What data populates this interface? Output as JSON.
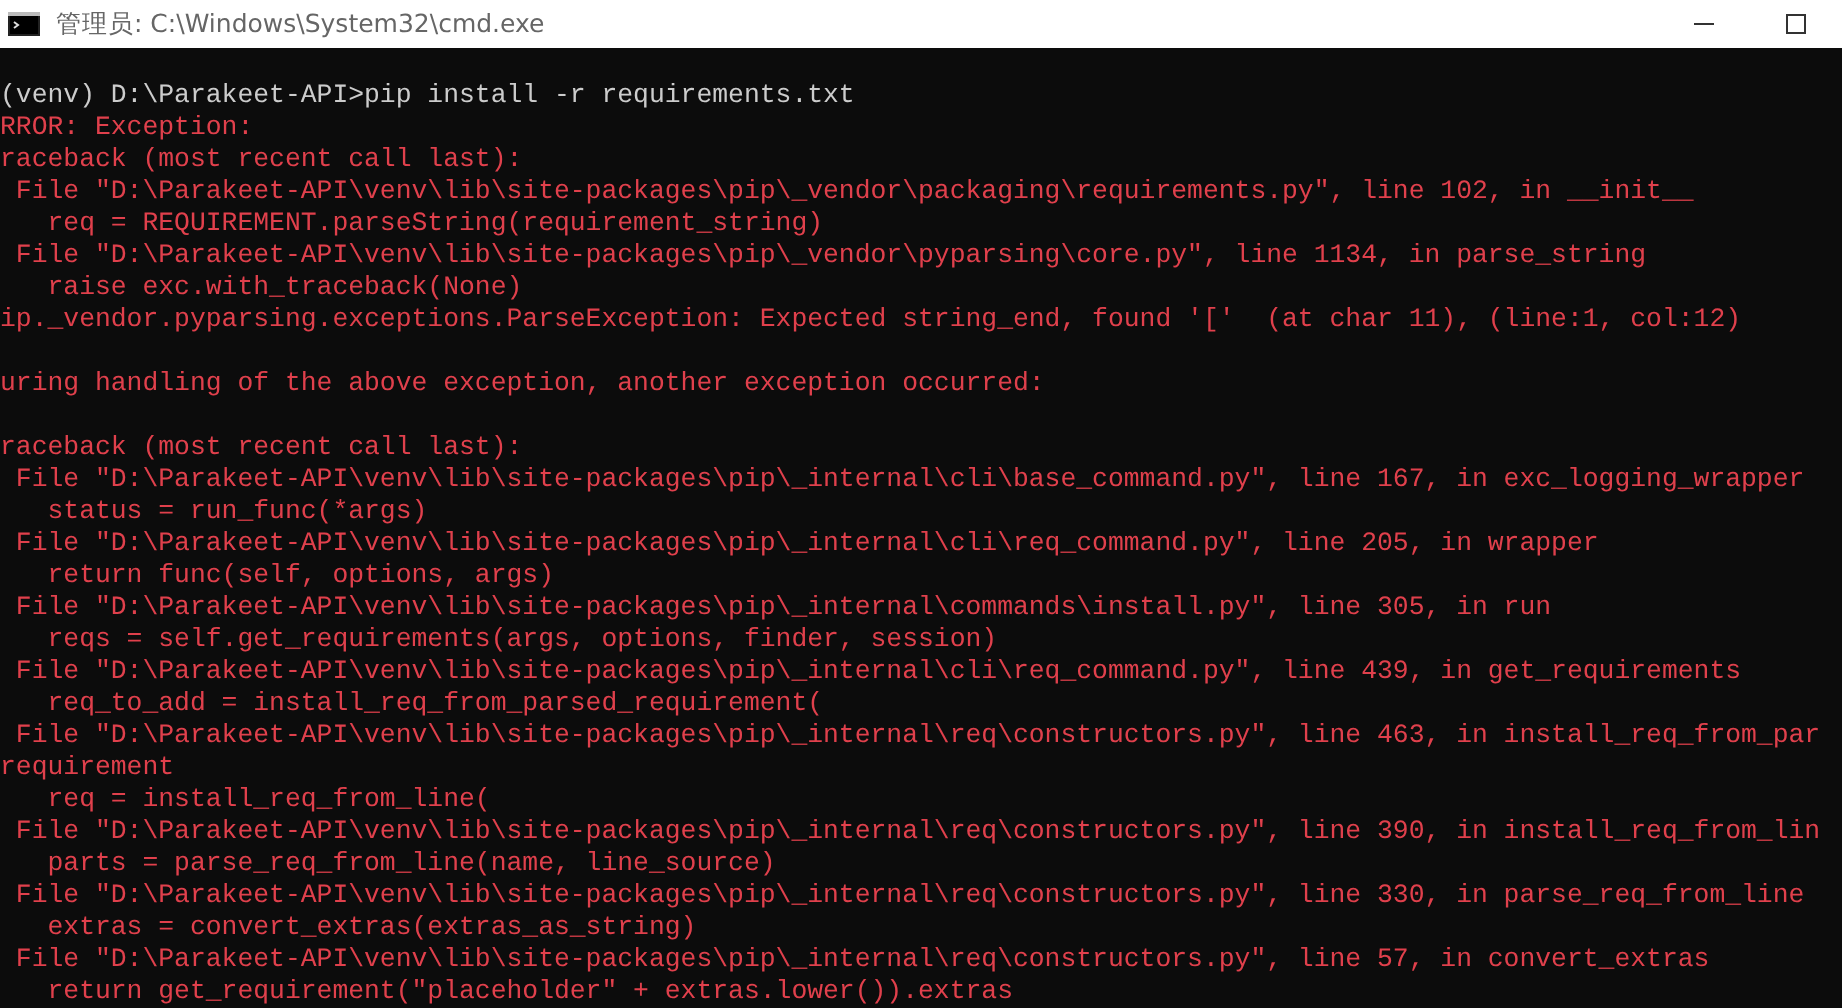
{
  "window": {
    "title": "管理员: C:\\Windows\\System32\\cmd.exe"
  },
  "console": {
    "lines": [
      {
        "kind": "command",
        "text": "(venv) D:\\Parakeet-API>pip install -r requirements.txt"
      },
      {
        "kind": "error",
        "text": "RROR: Exception:"
      },
      {
        "kind": "error",
        "text": "raceback (most recent call last):"
      },
      {
        "kind": "error",
        "text": " File \"D:\\Parakeet-API\\venv\\lib\\site-packages\\pip\\_vendor\\packaging\\requirements.py\", line 102, in __init__"
      },
      {
        "kind": "error",
        "text": "   req = REQUIREMENT.parseString(requirement_string)"
      },
      {
        "kind": "error",
        "text": " File \"D:\\Parakeet-API\\venv\\lib\\site-packages\\pip\\_vendor\\pyparsing\\core.py\", line 1134, in parse_string"
      },
      {
        "kind": "error",
        "text": "   raise exc.with_traceback(None)"
      },
      {
        "kind": "error",
        "text": "ip._vendor.pyparsing.exceptions.ParseException: Expected string_end, found '['  (at char 11), (line:1, col:12)"
      },
      {
        "kind": "blank"
      },
      {
        "kind": "error",
        "text": "uring handling of the above exception, another exception occurred:"
      },
      {
        "kind": "blank"
      },
      {
        "kind": "error",
        "text": "raceback (most recent call last):"
      },
      {
        "kind": "error",
        "text": " File \"D:\\Parakeet-API\\venv\\lib\\site-packages\\pip\\_internal\\cli\\base_command.py\", line 167, in exc_logging_wrapper"
      },
      {
        "kind": "error",
        "text": "   status = run_func(*args)"
      },
      {
        "kind": "error",
        "text": " File \"D:\\Parakeet-API\\venv\\lib\\site-packages\\pip\\_internal\\cli\\req_command.py\", line 205, in wrapper"
      },
      {
        "kind": "error",
        "text": "   return func(self, options, args)"
      },
      {
        "kind": "error",
        "text": " File \"D:\\Parakeet-API\\venv\\lib\\site-packages\\pip\\_internal\\commands\\install.py\", line 305, in run"
      },
      {
        "kind": "error",
        "text": "   reqs = self.get_requirements(args, options, finder, session)"
      },
      {
        "kind": "error",
        "text": " File \"D:\\Parakeet-API\\venv\\lib\\site-packages\\pip\\_internal\\cli\\req_command.py\", line 439, in get_requirements"
      },
      {
        "kind": "error",
        "text": "   req_to_add = install_req_from_parsed_requirement("
      },
      {
        "kind": "error",
        "text": " File \"D:\\Parakeet-API\\venv\\lib\\site-packages\\pip\\_internal\\req\\constructors.py\", line 463, in install_req_from_par"
      },
      {
        "kind": "error",
        "text": "requirement"
      },
      {
        "kind": "error",
        "text": "   req = install_req_from_line("
      },
      {
        "kind": "error",
        "text": " File \"D:\\Parakeet-API\\venv\\lib\\site-packages\\pip\\_internal\\req\\constructors.py\", line 390, in install_req_from_lin"
      },
      {
        "kind": "error",
        "text": "   parts = parse_req_from_line(name, line_source)"
      },
      {
        "kind": "error",
        "text": " File \"D:\\Parakeet-API\\venv\\lib\\site-packages\\pip\\_internal\\req\\constructors.py\", line 330, in parse_req_from_line"
      },
      {
        "kind": "error",
        "text": "   extras = convert_extras(extras_as_string)"
      },
      {
        "kind": "error",
        "text": " File \"D:\\Parakeet-API\\venv\\lib\\site-packages\\pip\\_internal\\req\\constructors.py\", line 57, in convert_extras"
      },
      {
        "kind": "error",
        "text": "   return get_requirement(\"placeholder\" + extras.lower()).extras"
      }
    ]
  }
}
